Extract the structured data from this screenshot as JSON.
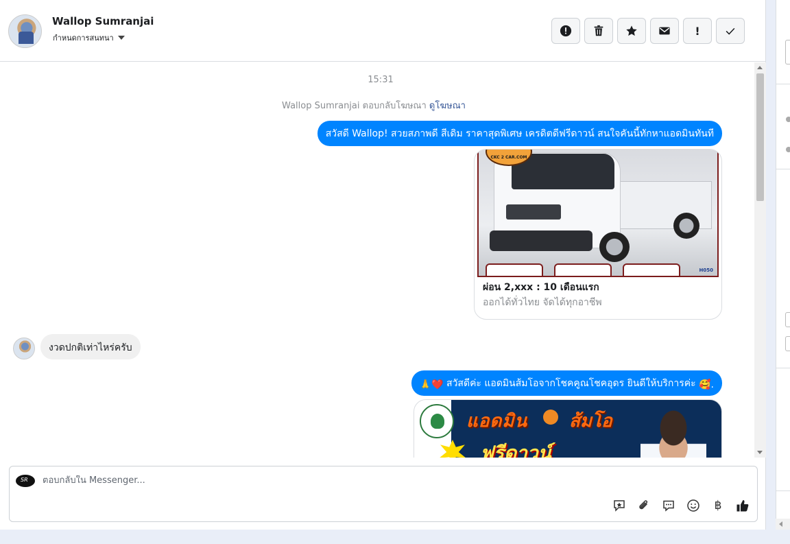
{
  "contact": {
    "name": "Wallop Sumranjai",
    "subtitle": "กำหนดการสนทนา"
  },
  "header_actions": [
    {
      "icon": "alert-circle-icon"
    },
    {
      "icon": "trash-icon"
    },
    {
      "icon": "star-icon"
    },
    {
      "icon": "envelope-icon"
    },
    {
      "icon": "exclamation-icon",
      "label": "!"
    },
    {
      "icon": "check-icon"
    }
  ],
  "messages": {
    "timestamp": "15:31",
    "ad_reply": {
      "prefix": "Wallop Sumranjai ตอบกลับโฆษณา",
      "link": "ดูโฆษณา"
    },
    "outgoing_1": "สวัสดี Wallop! สวยสภาพดี สีเดิม ราคาสุดพิเศษ เครดิตดีฟรีดาวน์  สนใจคันนี้ทักหาแอดมินทันที",
    "ad_card": {
      "logo_text": "CKC 2 CAR.COM",
      "code": "H050",
      "title": "ผ่อน 2,xxx : 10 เดือนแรก",
      "subtitle": "ออกได้ทั่วไทย จัดได้ทุกอาชีพ"
    },
    "incoming_1": "งวดปกติเท่าไหร่ครับ",
    "outgoing_2": {
      "emoji_prefix": "🙏❤️",
      "text": " สวัสดีค่ะ แอดมินส้มโอจากโชคคูณโชคอุดร ยินดีให้บริการค่ะ ",
      "emoji_suffix": "🥰."
    },
    "banner": {
      "line1": "แอดมิน",
      "line2": "ส้มโอ",
      "line3": "ฟรีดาวน์"
    }
  },
  "composer": {
    "placeholder": "ตอบกลับใน Messenger...",
    "tools": [
      "saved-reply-icon",
      "attachment-icon",
      "chat-bubble-icon",
      "emoji-icon",
      "baht-icon",
      "thumbs-up-icon"
    ],
    "baht_symbol": "฿"
  },
  "colors": {
    "accent": "#0084ff",
    "incoming_bubble": "#f0f0f0",
    "link": "#385898"
  }
}
